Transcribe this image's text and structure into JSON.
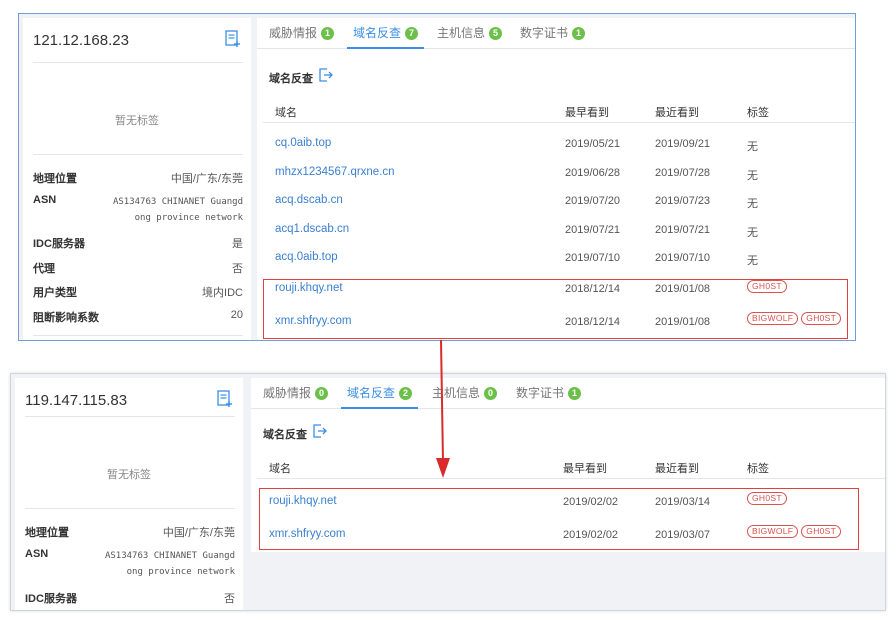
{
  "top": {
    "ip": "121.12.168.23",
    "no_tag": "暂无标签",
    "info": [
      {
        "k": "地理位置",
        "v": "中国/广东/东莞"
      },
      {
        "k": "ASN",
        "v": "AS134763 CHINANET Guangdong province network"
      },
      {
        "k": "IDC服务器",
        "v": "是"
      },
      {
        "k": "代理",
        "v": "否"
      },
      {
        "k": "用户类型",
        "v": "境内IDC"
      },
      {
        "k": "阻断影响系数",
        "v": "20"
      }
    ],
    "tabs": [
      {
        "label": "威胁情报",
        "count": "1"
      },
      {
        "label": "域名反查",
        "count": "7"
      },
      {
        "label": "主机信息",
        "count": "5"
      },
      {
        "label": "数字证书",
        "count": "1"
      }
    ],
    "section_title": "域名反查",
    "columns": [
      "域名",
      "最早看到",
      "最近看到",
      "标签"
    ],
    "rows": [
      {
        "domain": "cq.0aib.top",
        "first": "2019/05/21",
        "last": "2019/09/21",
        "tag": "无",
        "tags": []
      },
      {
        "domain": "mhzx1234567.qrxne.cn",
        "first": "2019/06/28",
        "last": "2019/07/28",
        "tag": "无",
        "tags": []
      },
      {
        "domain": "acq.dscab.cn",
        "first": "2019/07/20",
        "last": "2019/07/23",
        "tag": "无",
        "tags": []
      },
      {
        "domain": "acq1.dscab.cn",
        "first": "2019/07/21",
        "last": "2019/07/21",
        "tag": "无",
        "tags": []
      },
      {
        "domain": "acq.0aib.top",
        "first": "2019/07/10",
        "last": "2019/07/10",
        "tag": "无",
        "tags": []
      },
      {
        "domain": "rouji.khqy.net",
        "first": "2018/12/14",
        "last": "2019/01/08",
        "tag": "",
        "tags": [
          "GH0ST"
        ]
      },
      {
        "domain": "xmr.shfryy.com",
        "first": "2018/12/14",
        "last": "2019/01/08",
        "tag": "",
        "tags": [
          "BIGWOLF",
          "GH0ST"
        ]
      }
    ]
  },
  "bottom": {
    "ip": "119.147.115.83",
    "no_tag": "暂无标签",
    "info": [
      {
        "k": "地理位置",
        "v": "中国/广东/东莞"
      },
      {
        "k": "ASN",
        "v": "AS134763 CHINANET Guangdong province network"
      },
      {
        "k": "IDC服务器",
        "v": "否"
      }
    ],
    "tabs": [
      {
        "label": "威胁情报",
        "count": "0"
      },
      {
        "label": "域名反查",
        "count": "2"
      },
      {
        "label": "主机信息",
        "count": "0"
      },
      {
        "label": "数字证书",
        "count": "1"
      }
    ],
    "section_title": "域名反查",
    "columns": [
      "域名",
      "最早看到",
      "最近看到",
      "标签"
    ],
    "rows": [
      {
        "domain": "rouji.khqy.net",
        "first": "2019/02/02",
        "last": "2019/03/14",
        "tag": "",
        "tags": [
          "GH0ST"
        ]
      },
      {
        "domain": "xmr.shfryy.com",
        "first": "2019/02/02",
        "last": "2019/03/07",
        "tag": "",
        "tags": [
          "BIGWOLF",
          "GH0ST"
        ]
      }
    ]
  },
  "colors": {
    "accent": "#3a8ee6",
    "badge": "#6cc04a",
    "highlight": "#e04040",
    "tag": "#d9534f"
  }
}
